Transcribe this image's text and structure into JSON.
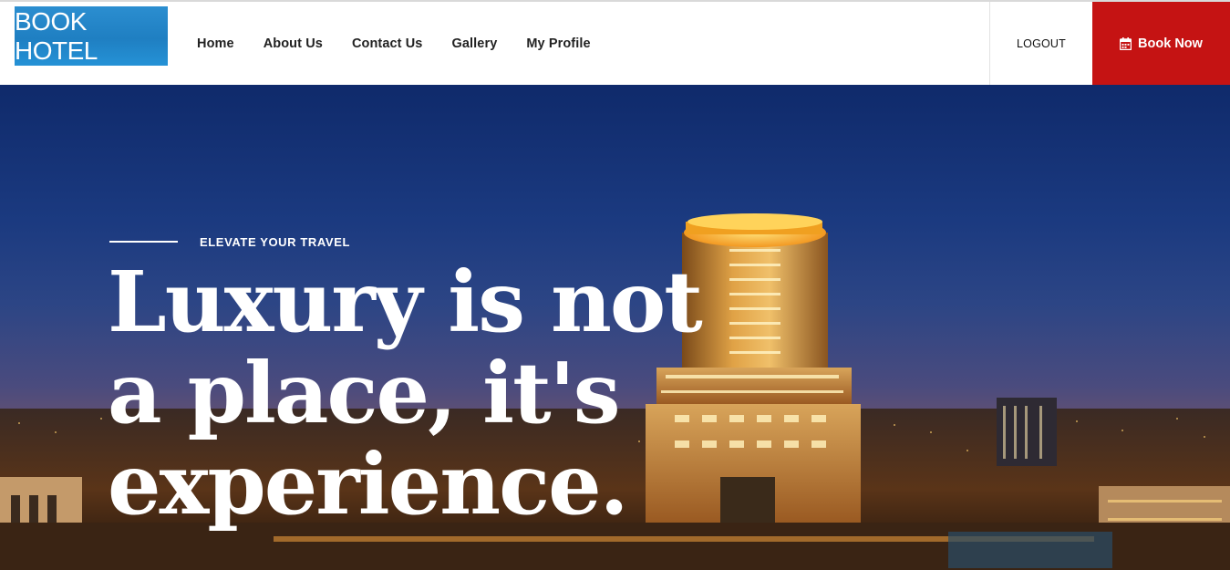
{
  "logo": {
    "text": "BOOK HOTEL"
  },
  "nav": {
    "items": [
      {
        "label": "Home"
      },
      {
        "label": "About Us"
      },
      {
        "label": "Contact Us"
      },
      {
        "label": "Gallery"
      },
      {
        "label": "My Profile"
      }
    ],
    "logout_label": "LOGOUT",
    "book_now_label": "Book Now"
  },
  "hero": {
    "kicker": "ELEVATE YOUR TRAVEL",
    "headline": {
      "line1": "Luxury is not",
      "line2": "a place, it's",
      "line3": "experience."
    }
  },
  "colors": {
    "brand_blue": "#2b8ed0",
    "book_now_red": "#c51313",
    "hero_sky": "#1b3a80"
  },
  "icons": {
    "book_now": "calendar-icon"
  }
}
